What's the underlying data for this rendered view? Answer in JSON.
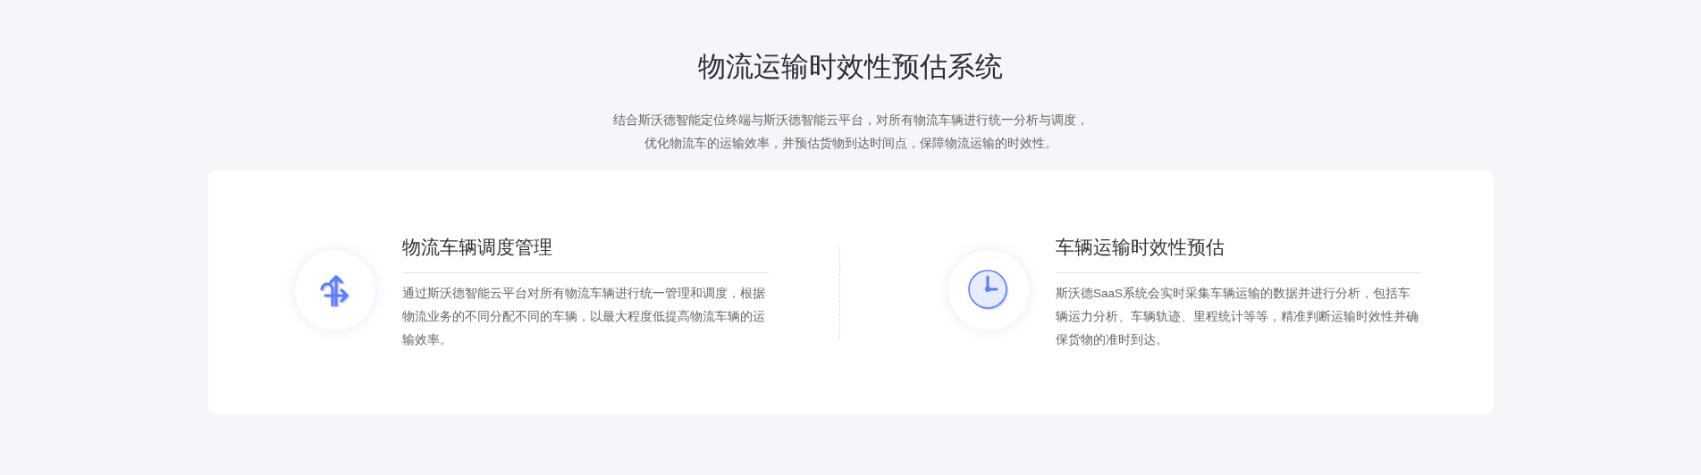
{
  "title": "物流运输时效性预估系统",
  "intro": [
    "结合斯沃德智能定位终端与斯沃德智能云平台，对所有物流车辆进行统一分析与调度，",
    "优化物流车的运输效率，并预估货物到达时间点，保障物流运输的时效性。"
  ],
  "features": [
    {
      "kind": "routing",
      "title": "物流车辆调度管理",
      "text": "通过斯沃德智能云平台对所有物流车辆进行统一管理和调度，根据物流业务的不同分配不同的车辆，以最大程度低提高物流车辆的运输效率。"
    },
    {
      "kind": "clock",
      "title": "车辆运输时效性预估",
      "text": "斯沃德SaaS系统会实时采集车辆运输的数据并进行分析，包括车辆运力分析、车辆轨迹、里程统计等等，精准判断运输时效性并确保货物的准时到达。"
    }
  ]
}
